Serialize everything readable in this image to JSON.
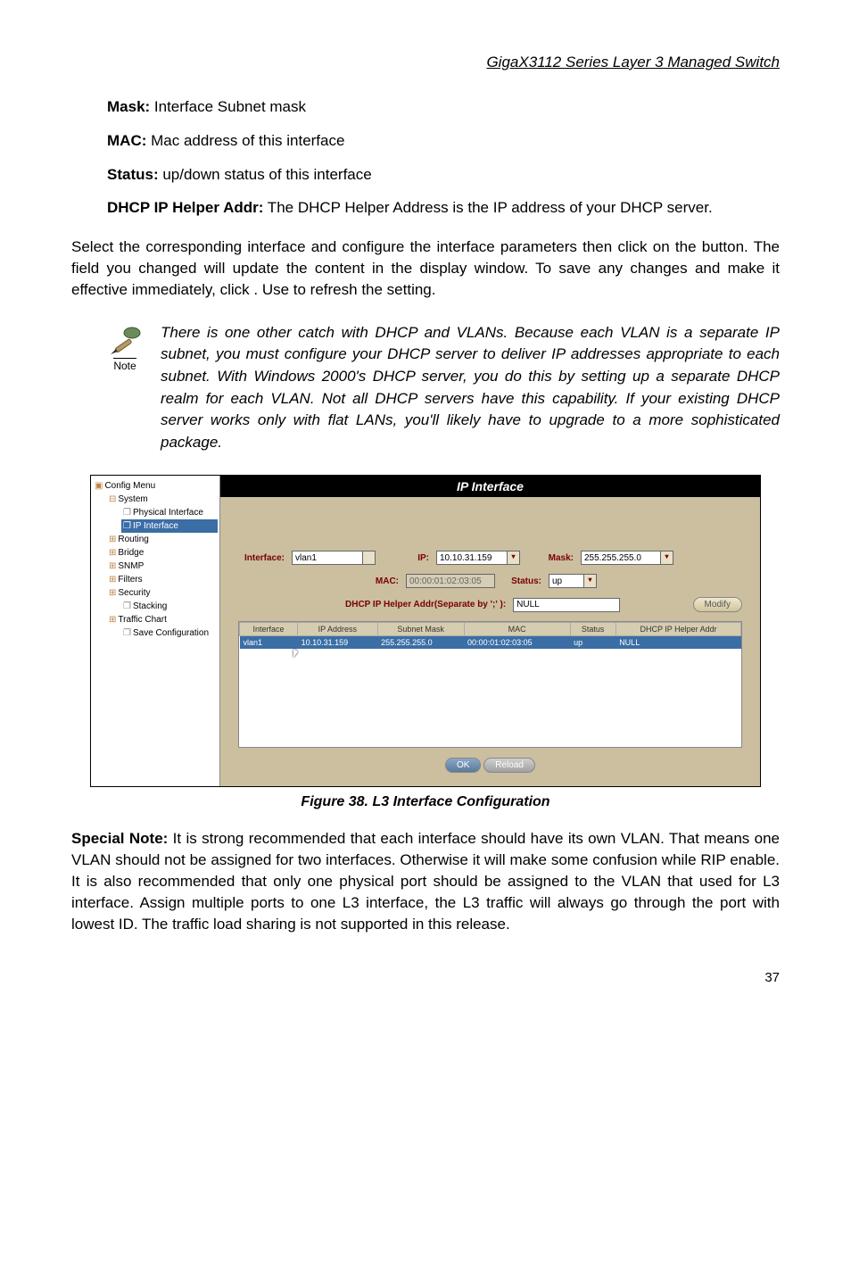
{
  "header": {
    "title": "GigaX3112 Series Layer 3 Managed Switch"
  },
  "definitions": {
    "mask": {
      "label": "Mask:",
      "text": " Interface Subnet mask"
    },
    "mac": {
      "label": "MAC:",
      "text": " Mac address of this interface"
    },
    "status": {
      "label": "Status:",
      "text": " up/down status of this interface"
    },
    "dhcp": {
      "label": "DHCP IP Helper Addr:",
      "text": " The DHCP Helper Address is the IP address of your DHCP server."
    }
  },
  "para1": "Select the corresponding interface and configure the interface parameters then click on the  button. The field you changed will update the content in the display window. To save any changes and make it effective immediately, click  . Use  to refresh the setting.",
  "note": {
    "label": "Note",
    "text": "There is one other catch with DHCP and VLANs. Because each VLAN is a separate IP subnet, you must configure your DHCP server to deliver IP addresses appropriate to each subnet. With Windows 2000's DHCP server, you do this by setting up a separate DHCP realm for each VLAN. Not all DHCP servers have this capability. If your existing DHCP server works only with flat LANs, you'll likely have to upgrade to a more sophisticated package."
  },
  "figure": {
    "caption": "Figure 38. L3 Interface Configuration",
    "tree": {
      "root": "Config Menu",
      "items": [
        "System",
        "Physical Interface",
        "IP Interface",
        "Routing",
        "Bridge",
        "SNMP",
        "Filters",
        "Security",
        "Stacking",
        "Traffic Chart",
        "Save Configuration"
      ]
    },
    "panel": {
      "title": "IP Interface",
      "labels": {
        "interface": "Interface:",
        "ip": "IP:",
        "mask": "Mask:",
        "mac": "MAC:",
        "status": "Status:",
        "dhcp": "DHCP IP Helper Addr(Separate by ';' ):"
      },
      "values": {
        "interface": "vlan1",
        "ip": "10.10.31.159",
        "mask": "255.255.255.0",
        "mac": "00:00:01:02:03:05",
        "status": "up",
        "dhcp": "NULL"
      },
      "modify": "Modify",
      "table": {
        "headers": [
          "Interface",
          "IP Address",
          "Subnet Mask",
          "MAC",
          "Status",
          "DHCP IP Helper Addr"
        ],
        "row": [
          "vlan1",
          "10.10.31.159",
          "255.255.255.0",
          "00:00:01:02:03:05",
          "up",
          "NULL"
        ]
      },
      "buttons": {
        "ok": "OK",
        "reload": "Reload"
      }
    }
  },
  "special": {
    "label": "Special Note:",
    "text": " It is strong recommended that each interface should have its own VLAN. That means one VLAN should not be assigned for two interfaces. Otherwise it will make some confusion while RIP enable. It is also recommended that only one physical port should be assigned to the VLAN that used for L3 interface. Assign multiple ports to one L3 interface, the L3 traffic will always go through the port with lowest ID. The traffic load sharing is not supported in this release."
  },
  "pageNumber": "37"
}
